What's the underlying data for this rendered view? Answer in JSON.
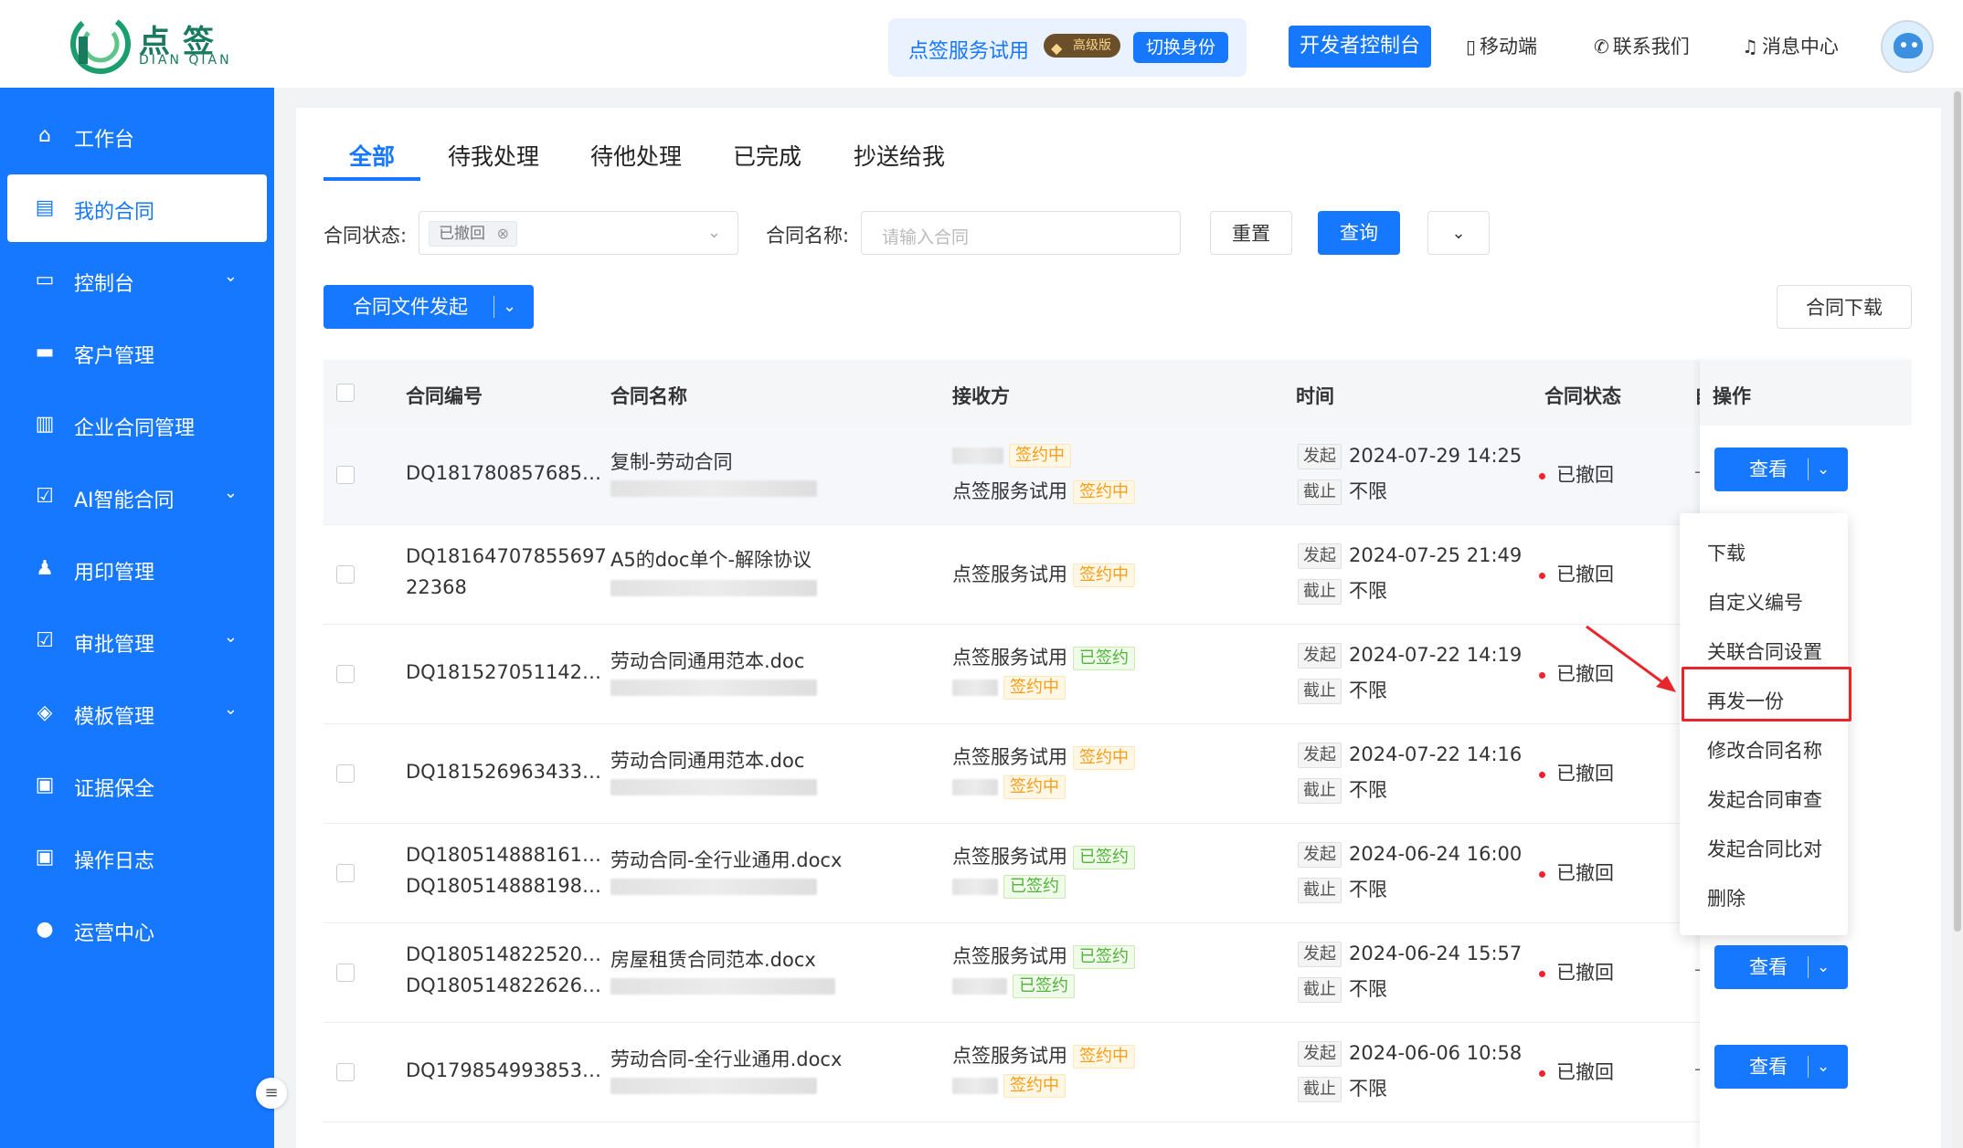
{
  "header": {
    "logo_text": "点签",
    "logo_sub": "DIAN QIAN",
    "trial_label": "点签服务试用",
    "edition_badge": "高级版",
    "switch_identity": "切换身份",
    "dev_console": "开发者控制台",
    "mobile": "移动端",
    "contact": "联系我们",
    "messages": "消息中心"
  },
  "sidebar": {
    "items": [
      {
        "label": "工作台",
        "icon": "home-icon"
      },
      {
        "label": "我的合同",
        "icon": "contract-icon"
      },
      {
        "label": "控制台",
        "icon": "console-icon"
      },
      {
        "label": "客户管理",
        "icon": "briefcase-icon"
      },
      {
        "label": "企业合同管理",
        "icon": "document-icon"
      },
      {
        "label": "AI智能合同",
        "icon": "ai-check-icon"
      },
      {
        "label": "用印管理",
        "icon": "seal-icon"
      },
      {
        "label": "审批管理",
        "icon": "approval-icon"
      },
      {
        "label": "模板管理",
        "icon": "layers-icon"
      },
      {
        "label": "证据保全",
        "icon": "evidence-icon"
      },
      {
        "label": "操作日志",
        "icon": "log-icon"
      },
      {
        "label": "运营中心",
        "icon": "user-icon"
      }
    ]
  },
  "tabs": [
    "全部",
    "待我处理",
    "待他处理",
    "已完成",
    "抄送给我"
  ],
  "filters": {
    "status_label": "合同状态:",
    "status_tag": "已撤回",
    "name_label": "合同名称:",
    "name_placeholder": "请输入合同",
    "reset": "重置",
    "search": "查询"
  },
  "actions": {
    "start_contract": "合同文件发起",
    "download_contract": "合同下载"
  },
  "table": {
    "columns": [
      "合同编号",
      "合同名称",
      "接收方",
      "时间",
      "合同状态",
      "自定",
      "操作"
    ],
    "start_label": "发起",
    "end_label": "截止",
    "view_label": "查看",
    "rows": [
      {
        "ids": [
          "DQ181780857685…"
        ],
        "name": "复制-劳动合同",
        "receivers": [
          {
            "name": "",
            "status": "签约中"
          },
          {
            "name": "点签服务试用",
            "status": "签约中"
          }
        ],
        "start": "2024-07-29 14:25",
        "end": "不限",
        "status": "已撤回",
        "custom": "—"
      },
      {
        "ids": [
          "DQ18164707855697",
          "22368"
        ],
        "name": "A5的doc单个-解除协议",
        "receivers": [
          {
            "name": "点签服务试用",
            "status": "签约中"
          }
        ],
        "start": "2024-07-25 21:49",
        "end": "不限",
        "status": "已撤回",
        "custom": ""
      },
      {
        "ids": [
          "DQ181527051142…"
        ],
        "name": "劳动合同通用范本.doc",
        "receivers": [
          {
            "name": "点签服务试用",
            "status": "已签约"
          },
          {
            "name": "",
            "status": "签约中"
          }
        ],
        "start": "2024-07-22 14:19",
        "end": "不限",
        "status": "已撤回",
        "custom": ""
      },
      {
        "ids": [
          "DQ181526963433…"
        ],
        "name": "劳动合同通用范本.doc",
        "receivers": [
          {
            "name": "点签服务试用",
            "status": "签约中"
          },
          {
            "name": "",
            "status": "签约中"
          }
        ],
        "start": "2024-07-22 14:16",
        "end": "不限",
        "status": "已撤回",
        "custom": ""
      },
      {
        "ids": [
          "DQ180514888161…",
          "DQ180514888198…"
        ],
        "name": "劳动合同-全行业通用.docx",
        "receivers": [
          {
            "name": "点签服务试用",
            "status": "已签约"
          },
          {
            "name": "",
            "status": "已签约"
          }
        ],
        "start": "2024-06-24 16:00",
        "end": "不限",
        "status": "已撤回",
        "custom": ""
      },
      {
        "ids": [
          "DQ180514822520…",
          "DQ180514822626…"
        ],
        "name": "房屋租赁合同范本.docx",
        "receivers": [
          {
            "name": "点签服务试用",
            "status": "已签约"
          },
          {
            "name": "",
            "status": "已签约"
          }
        ],
        "start": "2024-06-24 15:57",
        "end": "不限",
        "status": "已撤回",
        "custom": "—"
      },
      {
        "ids": [
          "DQ179854993853…"
        ],
        "name": "劳动合同-全行业通用.docx",
        "receivers": [
          {
            "name": "点签服务试用",
            "status": "签约中"
          },
          {
            "name": "",
            "status": "签约中"
          }
        ],
        "start": "2024-06-06 10:58",
        "end": "不限",
        "status": "已撤回",
        "custom": "—"
      }
    ]
  },
  "dropdown": {
    "items": [
      "下载",
      "自定义编号",
      "关联合同设置",
      "再发一份",
      "修改合同名称",
      "发起合同审查",
      "发起合同比对",
      "删除"
    ],
    "highlighted": "再发一份"
  },
  "colors": {
    "primary": "#1677ff",
    "highlight_red": "#e8262b",
    "signing": "#fa9d14",
    "signed": "#52b33b"
  }
}
